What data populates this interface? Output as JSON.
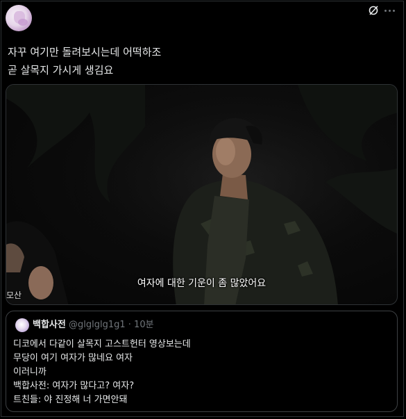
{
  "tweet": {
    "text": "자꾸 여기만 돌려보시는데 어떡하조\n곧 살목지 가시게 생김요",
    "grok_icon": "grok-icon",
    "more_icon": "more-icon"
  },
  "media": {
    "caption": "여자에 대한 기운이 좀 많았어요",
    "watermark": "모산"
  },
  "quote": {
    "name": "백합사전",
    "handle": "@glglglg1g1",
    "separator": "·",
    "time": "10분",
    "text": "디코에서 다같이 살목지 고스트헌터 영상보는데\n무당이 여기 여자가 많네요 여자\n이러니까\n백합사전: 여자가 많다고? 여자?\n트친들: 야 진정해 너 가면안돼"
  }
}
